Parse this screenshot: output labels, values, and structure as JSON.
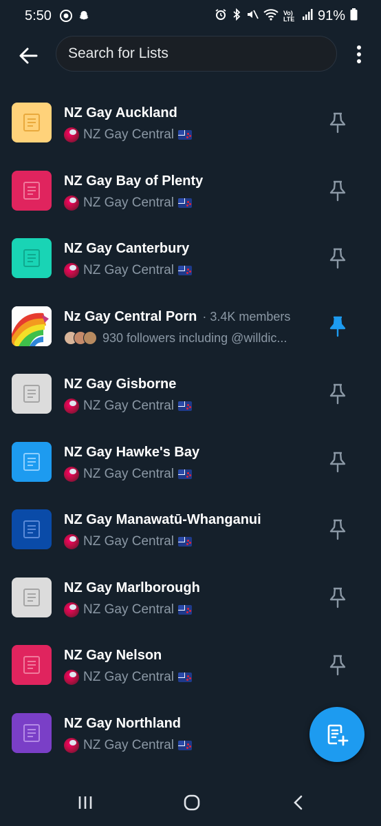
{
  "status_bar": {
    "time": "5:50",
    "battery_pct": "91%",
    "network_label": "Vo) LTE",
    "icons": [
      "whatsapp-icon",
      "snapchat-icon",
      "alarm-icon",
      "bluetooth-icon",
      "mute-icon",
      "wifi-icon",
      "volte-icon",
      "signal-icon",
      "battery-icon"
    ]
  },
  "search": {
    "placeholder": "Search for Lists"
  },
  "lists": [
    {
      "name": "NZ Gay Auckland",
      "owner": "NZ Gay Central",
      "icon_color": "#ffd27a",
      "icon_fg": "#e9a93c",
      "pinned": false
    },
    {
      "name": "NZ Gay Bay of Plenty",
      "owner": "NZ Gay Central",
      "icon_color": "#e0245e",
      "icon_fg": "#f07a9c",
      "pinned": false
    },
    {
      "name": "NZ Gay Canterbury",
      "owner": "NZ Gay Central",
      "icon_color": "#19d4b5",
      "icon_fg": "#0fa88e",
      "pinned": false
    },
    {
      "name": "Nz Gay Central Porn",
      "members": "· 3.4K members",
      "followers": "930 followers including @willdic...",
      "pinned": true,
      "image": "rainbow-photo"
    },
    {
      "name": "NZ Gay Gisborne",
      "owner": "NZ Gay Central",
      "icon_color": "#dcdcdc",
      "icon_fg": "#a5a5a5",
      "pinned": false
    },
    {
      "name": "NZ Gay Hawke's Bay",
      "owner": "NZ Gay Central",
      "icon_color": "#1d9bf0",
      "icon_fg": "#8fd0ff",
      "pinned": false
    },
    {
      "name": "NZ Gay Manawatū-Whanganui",
      "owner": "NZ Gay Central",
      "icon_color": "#0a4ba8",
      "icon_fg": "#5a8ad8",
      "pinned": false
    },
    {
      "name": "NZ Gay Marlborough",
      "owner": "NZ Gay Central",
      "icon_color": "#dcdcdc",
      "icon_fg": "#a5a5a5",
      "pinned": false
    },
    {
      "name": "NZ Gay Nelson",
      "owner": "NZ Gay Central",
      "icon_color": "#e0245e",
      "icon_fg": "#f07a9c",
      "pinned": false
    },
    {
      "name": "NZ Gay Northland",
      "owner": "NZ Gay Central",
      "icon_color": "#7a3fc7",
      "icon_fg": "#b48ae6",
      "pinned": false
    }
  ],
  "colors": {
    "background": "#15202b",
    "accent": "#1d9bf0",
    "secondary_text": "#8b98a5",
    "pin_inactive": "#8b98a5"
  }
}
